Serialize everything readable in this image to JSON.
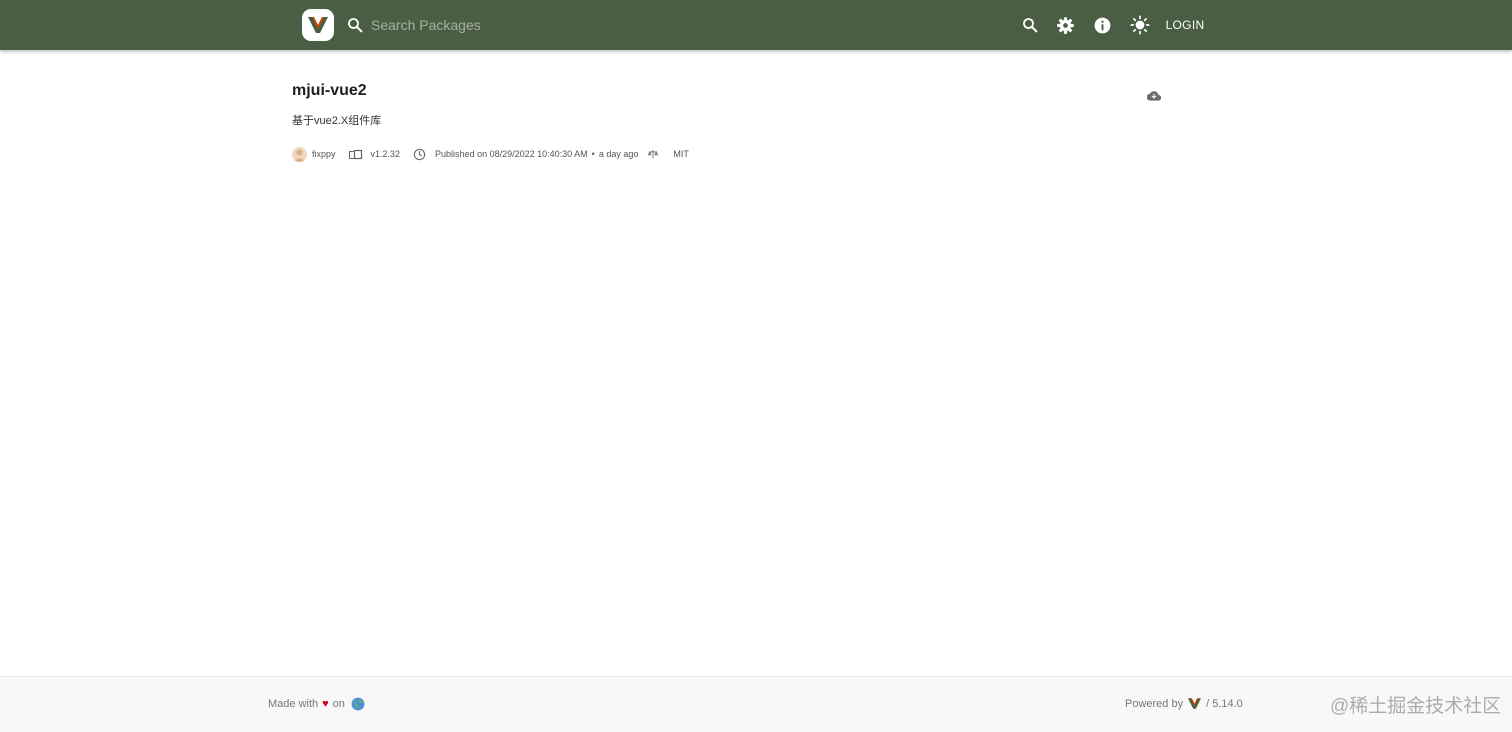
{
  "header": {
    "search_placeholder": "Search Packages",
    "login_label": "LOGIN",
    "icons": [
      "search-icon",
      "gear-icon",
      "info-icon",
      "theme-brightness-icon"
    ],
    "background_color": "#4a5e43"
  },
  "package": {
    "name": "mjui-vue2",
    "description": "基于vue2.X组件库",
    "author": "fixppy",
    "version": "v1.2.32",
    "published": "Published on 08/29/2022 10:40:30 AM",
    "separator": "•",
    "relative_time": "a day ago",
    "license": "MIT"
  },
  "footer": {
    "made_with": "Made with",
    "heart": "♥",
    "on": "on",
    "powered_by": "Powered by",
    "version": "/ 5.14.0",
    "watermark": "@稀土掘金技术社区"
  }
}
